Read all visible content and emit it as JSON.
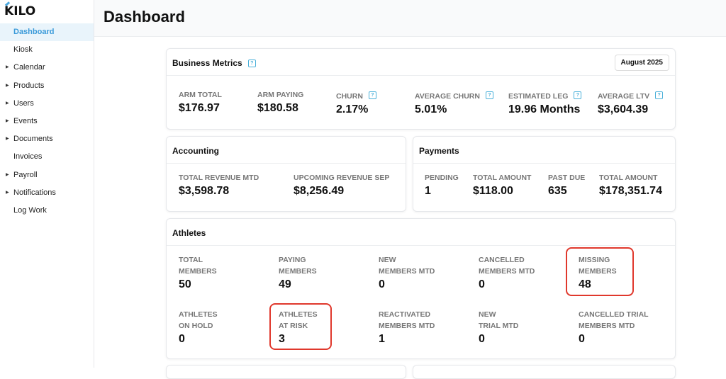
{
  "app": {
    "logo": "KILO",
    "page_title": "Dashboard"
  },
  "sidebar": {
    "items": [
      {
        "label": "Dashboard",
        "active": true,
        "expandable": false
      },
      {
        "label": "Kiosk",
        "expandable": false
      },
      {
        "label": "Calendar",
        "expandable": true
      },
      {
        "label": "Products",
        "expandable": true
      },
      {
        "label": "Users",
        "expandable": true
      },
      {
        "label": "Events",
        "expandable": true
      },
      {
        "label": "Documents",
        "expandable": true
      },
      {
        "label": "Invoices",
        "expandable": false
      },
      {
        "label": "Payroll",
        "expandable": true
      },
      {
        "label": "Notifications",
        "expandable": true
      },
      {
        "label": "Log Work",
        "expandable": false
      }
    ]
  },
  "business": {
    "title": "Business Metrics",
    "month": "August 2025",
    "metrics": [
      {
        "label": "ARM TOTAL",
        "value": "$176.97"
      },
      {
        "label": "ARM PAYING",
        "value": "$180.58"
      },
      {
        "label": "CHURN",
        "value": "2.17%"
      },
      {
        "label": "AVERAGE CHURN",
        "value": "5.01%"
      },
      {
        "label": "ESTIMATED LEG",
        "value": "19.96 Months"
      },
      {
        "label": "AVERAGE LTV",
        "value": "$3,604.39"
      }
    ]
  },
  "accounting": {
    "title": "Accounting",
    "metrics": [
      {
        "label": "TOTAL REVENUE MTD",
        "value": "$3,598.78"
      },
      {
        "label": "UPCOMING REVENUE SEP",
        "value": "$8,256.49"
      }
    ]
  },
  "payments": {
    "title": "Payments",
    "metrics": [
      {
        "label": "PENDING",
        "value": "1"
      },
      {
        "label": "TOTAL AMOUNT",
        "value": "$118.00"
      },
      {
        "label": "PAST DUE",
        "value": "635"
      },
      {
        "label": "TOTAL AMOUNT",
        "value": "$178,351.74"
      }
    ]
  },
  "athletes": {
    "title": "Athletes",
    "metrics": [
      {
        "l1": "TOTAL",
        "l2": "MEMBERS",
        "value": "50"
      },
      {
        "l1": "PAYING",
        "l2": "MEMBERS",
        "value": "49"
      },
      {
        "l1": "NEW",
        "l2": "MEMBERS MTD",
        "value": "0"
      },
      {
        "l1": "CANCELLED",
        "l2": "MEMBERS MTD",
        "value": "0"
      },
      {
        "l1": "MISSING",
        "l2": "MEMBERS",
        "value": "48"
      },
      {
        "l1": "ATHLETES",
        "l2": "ON HOLD",
        "value": "0"
      },
      {
        "l1": "ATHLETES",
        "l2": "AT RISK",
        "value": "3"
      },
      {
        "l1": "REACTIVATED",
        "l2": "MEMBERS MTD",
        "value": "1"
      },
      {
        "l1": "NEW",
        "l2": "TRIAL MTD",
        "value": "0"
      },
      {
        "l1": "CANCELLED TRIAL",
        "l2": "MEMBERS MTD",
        "value": "0"
      }
    ]
  },
  "help_glyph": "?"
}
